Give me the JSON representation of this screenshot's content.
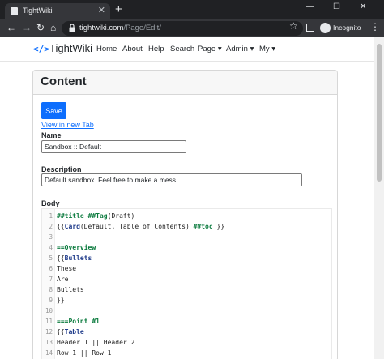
{
  "browser": {
    "tab_title": "TightWiki",
    "url_host": "tightwiki.com",
    "url_path": "/Page/Edit/",
    "profile_label": "Incognito"
  },
  "icons": {
    "favicon": "page-icon",
    "close": "close-icon",
    "new_tab": "plus-icon",
    "minimize": "minimize-icon",
    "maximize": "maximize-icon",
    "close_window": "close-icon",
    "back": "arrow-left-icon",
    "forward": "arrow-right-icon",
    "reload": "reload-icon",
    "home": "home-icon",
    "lock": "lock-icon",
    "bookmark": "star-icon",
    "side_panel": "side-panel-icon",
    "incognito": "incognito-icon",
    "menu": "kebab-icon",
    "brand": "code-icon"
  },
  "site": {
    "brand": "TightWiki",
    "nav": [
      {
        "label": "Home"
      },
      {
        "label": "About"
      },
      {
        "label": "Help"
      },
      {
        "label": "Search"
      },
      {
        "label": "Page ▾"
      },
      {
        "label": "Admin ▾"
      },
      {
        "label": "My ▾"
      }
    ]
  },
  "content": {
    "header": "Content",
    "save_label": "Save",
    "view_link": "View in new Tab",
    "name_label": "Name",
    "name_value": "Sandbox :: Default",
    "description_label": "Description",
    "description_value": "Default sandbox. Feel free to make a mess.",
    "body_label": "Body"
  },
  "editor_lines": [
    {
      "n": "1",
      "parts": [
        {
          "t": "##title ##Tag",
          "c": "kw-title"
        },
        {
          "t": "(Draft)",
          "c": ""
        }
      ]
    },
    {
      "n": "2",
      "parts": [
        {
          "t": "{{",
          "c": ""
        },
        {
          "t": "Card",
          "c": "kw-fn"
        },
        {
          "t": "(Default, Table of Contents) ",
          "c": ""
        },
        {
          "t": "##toc",
          "c": "kw-tag"
        },
        {
          "t": " }}",
          "c": ""
        }
      ]
    },
    {
      "n": "3",
      "parts": []
    },
    {
      "n": "4",
      "parts": [
        {
          "t": "==Overview",
          "c": "kw-title"
        }
      ]
    },
    {
      "n": "5",
      "parts": [
        {
          "t": "{{",
          "c": ""
        },
        {
          "t": "Bullets",
          "c": "kw-fn"
        }
      ]
    },
    {
      "n": "6",
      "parts": [
        {
          "t": "These",
          "c": ""
        }
      ]
    },
    {
      "n": "7",
      "parts": [
        {
          "t": "Are",
          "c": ""
        }
      ]
    },
    {
      "n": "8",
      "parts": [
        {
          "t": "Bullets",
          "c": ""
        }
      ]
    },
    {
      "n": "9",
      "parts": [
        {
          "t": "}}",
          "c": ""
        }
      ]
    },
    {
      "n": "10",
      "parts": []
    },
    {
      "n": "11",
      "parts": [
        {
          "t": "===Point #1",
          "c": "kw-title"
        }
      ]
    },
    {
      "n": "12",
      "parts": [
        {
          "t": "{{",
          "c": ""
        },
        {
          "t": "Table",
          "c": "kw-fn"
        }
      ]
    },
    {
      "n": "13",
      "parts": [
        {
          "t": "Header 1 || Header 2",
          "c": ""
        }
      ]
    },
    {
      "n": "14",
      "parts": [
        {
          "t": "Row 1 || Row 1",
          "c": ""
        }
      ]
    }
  ]
}
